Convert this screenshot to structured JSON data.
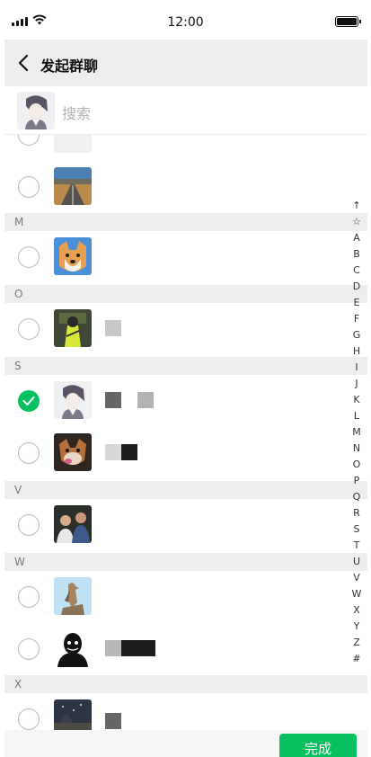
{
  "status_bar": {
    "time": "12:00"
  },
  "nav": {
    "title": "发起群聊"
  },
  "search": {
    "placeholder": "搜索"
  },
  "sections": {
    "m": "M",
    "o": "O",
    "s": "S",
    "v": "V",
    "w": "W",
    "x": "X"
  },
  "index_bar": [
    "↑",
    "☆",
    "A",
    "B",
    "C",
    "D",
    "E",
    "F",
    "G",
    "H",
    "I",
    "J",
    "K",
    "L",
    "M",
    "N",
    "O",
    "P",
    "Q",
    "R",
    "S",
    "T",
    "U",
    "V",
    "W",
    "X",
    "Y",
    "Z",
    "#"
  ],
  "contacts": [
    {
      "section": "",
      "selected": false,
      "avatar": "partial-avatar"
    },
    {
      "section": "",
      "selected": false,
      "avatar": "road-landscape-avatar"
    },
    {
      "section": "M",
      "selected": false,
      "avatar": "shiba-dog-avatar"
    },
    {
      "section": "O",
      "selected": false,
      "avatar": "yellow-figure-avatar"
    },
    {
      "section": "S",
      "selected": true,
      "avatar": "anime-character-avatar"
    },
    {
      "section": "S",
      "selected": false,
      "avatar": "dog-face-avatar"
    },
    {
      "section": "V",
      "selected": false,
      "avatar": "two-people-avatar"
    },
    {
      "section": "W",
      "selected": false,
      "avatar": "bird-avatar"
    },
    {
      "section": "W",
      "selected": false,
      "avatar": "dark-silhouette-avatar"
    },
    {
      "section": "X",
      "selected": false,
      "avatar": "night-scene-avatar"
    }
  ],
  "footer": {
    "done_label": "完成"
  },
  "colors": {
    "accent": "#07c160",
    "nav_bg": "#ededed",
    "section_bg": "#ededed"
  }
}
